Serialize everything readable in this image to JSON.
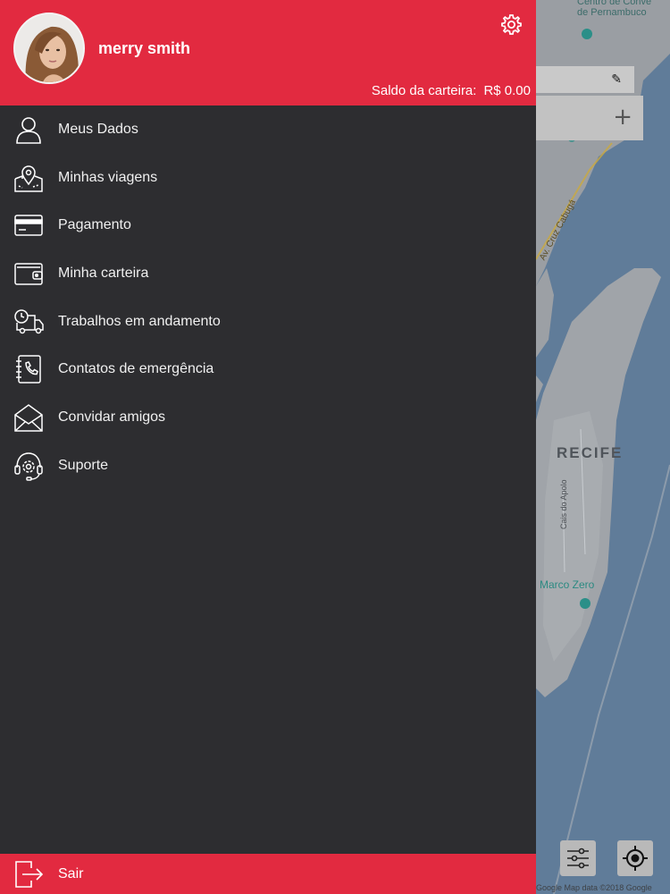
{
  "user": {
    "name": "merry smith"
  },
  "wallet": {
    "label": "Saldo da carteira:",
    "amount": "R$ 0.00"
  },
  "menu": {
    "items": [
      {
        "label": "Meus Dados",
        "icon": "user-icon"
      },
      {
        "label": "Minhas viagens",
        "icon": "map-pin-icon"
      },
      {
        "label": "Pagamento",
        "icon": "credit-card-icon"
      },
      {
        "label": "Minha carteira",
        "icon": "wallet-icon"
      },
      {
        "label": "Trabalhos em andamento",
        "icon": "truck-clock-icon"
      },
      {
        "label": "Contatos de emergência",
        "icon": "phone-book-icon"
      },
      {
        "label": "Convidar amigos",
        "icon": "envelope-icon"
      },
      {
        "label": "Suporte",
        "icon": "support-headset-icon"
      }
    ]
  },
  "logout": {
    "label": "Sair",
    "icon": "logout-icon"
  },
  "map": {
    "city_label": "RECIFE",
    "poi_marco_zero": "Marco Zero",
    "poi_centro": "Centro de Conve\nde Pernambuco",
    "street_cruz": "Av. Cruz Cabugá",
    "street_cais": "Cais do Apolo",
    "attribution": "Google   Map data ©2018 Google"
  },
  "colors": {
    "brand": "#e22a40",
    "drawer": "#2d2d30"
  }
}
